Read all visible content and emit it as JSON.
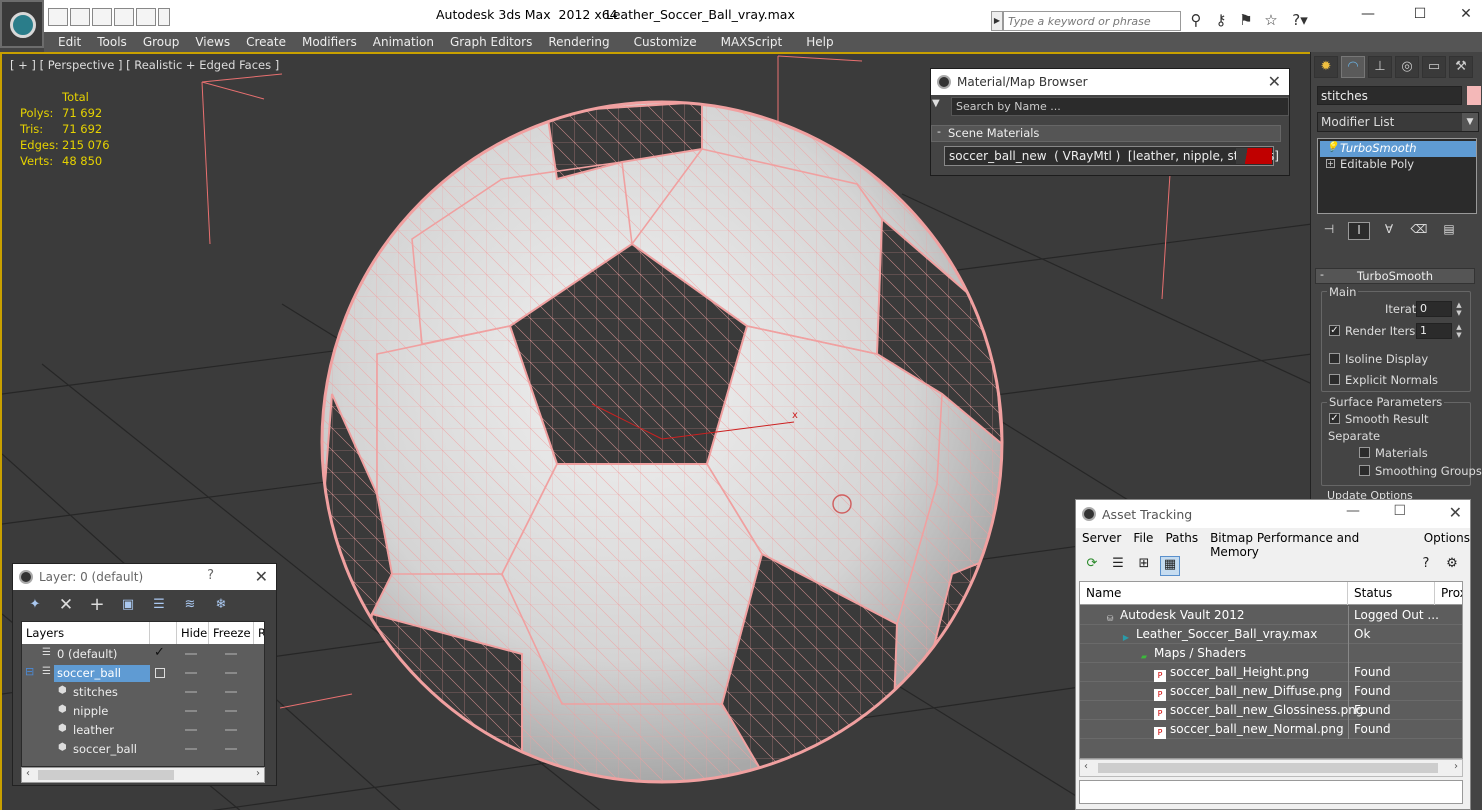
{
  "app": {
    "title": "Autodesk 3ds Max  2012 x64",
    "file": "Leather_Soccer_Ball_vray.max",
    "search_placeholder": "Type a keyword or phrase"
  },
  "menu": [
    "Edit",
    "Tools",
    "Group",
    "Views",
    "Create",
    "Modifiers",
    "Animation",
    "Graph Editors",
    "Rendering",
    "Customize",
    "MAXScript",
    "Help"
  ],
  "viewport": {
    "label": "[ + ] [ Perspective ] [ Realistic + Edged Faces ]",
    "stats": {
      "header": "Total",
      "rows": [
        {
          "k": "Polys:",
          "v": "71 692"
        },
        {
          "k": "Tris:",
          "v": "71 692"
        },
        {
          "k": "Edges:",
          "v": "215 076"
        },
        {
          "k": "Verts:",
          "v": "48 850"
        }
      ]
    },
    "axis_label": "x"
  },
  "material_browser": {
    "title": "Material/Map Browser",
    "search": "Search by Name ...",
    "group": "Scene Materials",
    "entry": "soccer_ball_new  ( VRayMtl )  [leather, nipple, stitches]"
  },
  "command_panel": {
    "object_name": "stitches",
    "modifier_list": "Modifier List",
    "stack": [
      "TurboSmooth",
      "Editable Poly"
    ],
    "rollout": "TurboSmooth",
    "main_group": "Main",
    "iterations_label": "Iterations:",
    "iterations": "0",
    "render_iters_label": "Render Iters:",
    "render_iters": "1",
    "isoline": "Isoline Display",
    "explicit": "Explicit Normals",
    "surface_group": "Surface Parameters",
    "smooth_result": "Smooth Result",
    "separate": "Separate",
    "materials": "Materials",
    "smoothing_groups": "Smoothing Groups",
    "update_group": "Update Options"
  },
  "asset_tracking": {
    "title": "Asset Tracking",
    "menu": [
      "Server",
      "File",
      "Paths",
      "Bitmap Performance and Memory",
      "Options"
    ],
    "columns": [
      "Name",
      "Status",
      "Prox"
    ],
    "rows": [
      {
        "name": "Autodesk Vault 2012",
        "status": "Logged Out ...",
        "indent": 24,
        "icon": "vault"
      },
      {
        "name": "Leather_Soccer_Ball_vray.max",
        "status": "Ok",
        "indent": 40,
        "icon": "max"
      },
      {
        "name": "Maps / Shaders",
        "status": "",
        "indent": 58,
        "icon": "maps"
      },
      {
        "name": "soccer_ball_Height.png",
        "status": "Found",
        "indent": 74,
        "icon": "png"
      },
      {
        "name": "soccer_ball_new_Diffuse.png",
        "status": "Found",
        "indent": 74,
        "icon": "png"
      },
      {
        "name": "soccer_ball_new_Glossiness.png",
        "status": "Found",
        "indent": 74,
        "icon": "png"
      },
      {
        "name": "soccer_ball_new_Normal.png",
        "status": "Found",
        "indent": 74,
        "icon": "png"
      }
    ]
  },
  "layer_dialog": {
    "title": "Layer: 0 (default)",
    "help": "?",
    "columns": [
      "Layers",
      "Hide",
      "Freeze",
      "R"
    ],
    "rows": [
      {
        "name": "0 (default)",
        "indent": 20,
        "sel": false,
        "check": true
      },
      {
        "name": "soccer_ball",
        "indent": 20,
        "sel": true,
        "check": false
      },
      {
        "name": "stitches",
        "indent": 36,
        "sel": false,
        "check": false
      },
      {
        "name": "nipple",
        "indent": 36,
        "sel": false,
        "check": false
      },
      {
        "name": "leather",
        "indent": 36,
        "sel": false,
        "check": false
      },
      {
        "name": "soccer_ball",
        "indent": 36,
        "sel": false,
        "check": false
      }
    ]
  },
  "colors": {
    "accent": "#5f9bd3",
    "wire": "#f0a0a0",
    "stats": "#e6d200",
    "material_swatch": "#c00000"
  }
}
